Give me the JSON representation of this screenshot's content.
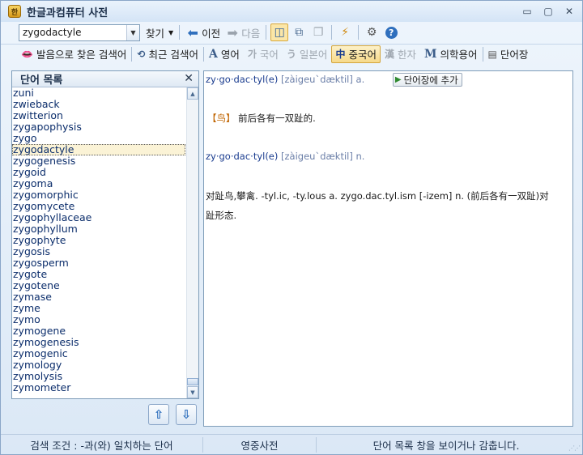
{
  "window": {
    "title": "한글과컴퓨터 사전",
    "app_icon_text": "한"
  },
  "toolbar1": {
    "search_value": "zygodactyle",
    "find_label": "찾기",
    "back_label": "이전",
    "forward_label": "다음"
  },
  "toolbar2": {
    "items": [
      {
        "label": "발음으로 찾은 검색어",
        "icon": "lips-icon",
        "glyph": "👄",
        "enabled": true,
        "selected": false
      },
      {
        "label": "최근 검색어",
        "icon": "recent-icon",
        "glyph": "⟲",
        "enabled": true,
        "selected": false
      },
      {
        "label": "영어",
        "icon": "letter-a-icon",
        "glyph": "A",
        "enabled": true,
        "selected": false
      },
      {
        "label": "국어",
        "icon": "hangul-ga-icon",
        "glyph": "가",
        "enabled": false,
        "selected": false
      },
      {
        "label": "일본어",
        "icon": "kana-icon",
        "glyph": "う",
        "enabled": false,
        "selected": false
      },
      {
        "label": "중국어",
        "icon": "hanzi-zhong-icon",
        "glyph": "中",
        "enabled": true,
        "selected": true
      },
      {
        "label": "한자",
        "icon": "hanja-icon",
        "glyph": "漢",
        "enabled": false,
        "selected": false
      },
      {
        "label": "의학용어",
        "icon": "letter-m-icon",
        "glyph": "M",
        "enabled": true,
        "selected": false
      },
      {
        "label": "단어장",
        "icon": "wordbook-icon",
        "glyph": "▤",
        "enabled": true,
        "selected": false
      }
    ]
  },
  "word_list": {
    "title": "단어 목록",
    "close_glyph": "✕",
    "items": [
      "zuni",
      "zwieback",
      "zwitterion",
      "zygapophysis",
      "zygo",
      "zygodactyle",
      "zygogenesis",
      "zygoid",
      "zygoma",
      "zygomorphic",
      "zygomycete",
      "zygophyllaceae",
      "zygophyllum",
      "zygophyte",
      "zygosis",
      "zygosperm",
      "zygote",
      "zygotene",
      "zymase",
      "zyme",
      "zymo",
      "zymogene",
      "zymogenesis",
      "zymogenic",
      "zymology",
      "zymolysis",
      "zymometer"
    ],
    "selected": "zygodactyle"
  },
  "definition": {
    "entry1": {
      "headword": "zy·go·dac·tyl(e)",
      "pronunciation": "[zàigeu`dæktil]",
      "pos": "a.",
      "add_button": "단어장에 추가"
    },
    "sense1": {
      "tag": "【鸟】",
      "text": "前后各有一双趾的."
    },
    "entry2": {
      "headword": "zy·go·dac·tyl(e)",
      "pronunciation": "[zàigeu`dæktil]",
      "pos": "n."
    },
    "sense2": {
      "line1": "对趾鸟,攀禽. -tyl.ic, -ty.lous a. zygo.dac.tyl.ism [-izem] n. (前后各有一双趾)对",
      "line2": "趾形态."
    }
  },
  "statusbar": {
    "search_condition": "검색 조건 : -과(와) 일치하는 단어",
    "dictionary": "영중사전",
    "hint": "단어 목록 창을 보이거나 감춥니다."
  },
  "colors": {
    "accent": "#2f6fbd",
    "headword": "#1a3c8f",
    "pronunciation": "#6b7fa8",
    "tag": "#c06400",
    "selected_lang_bg": "#f6d98a"
  }
}
